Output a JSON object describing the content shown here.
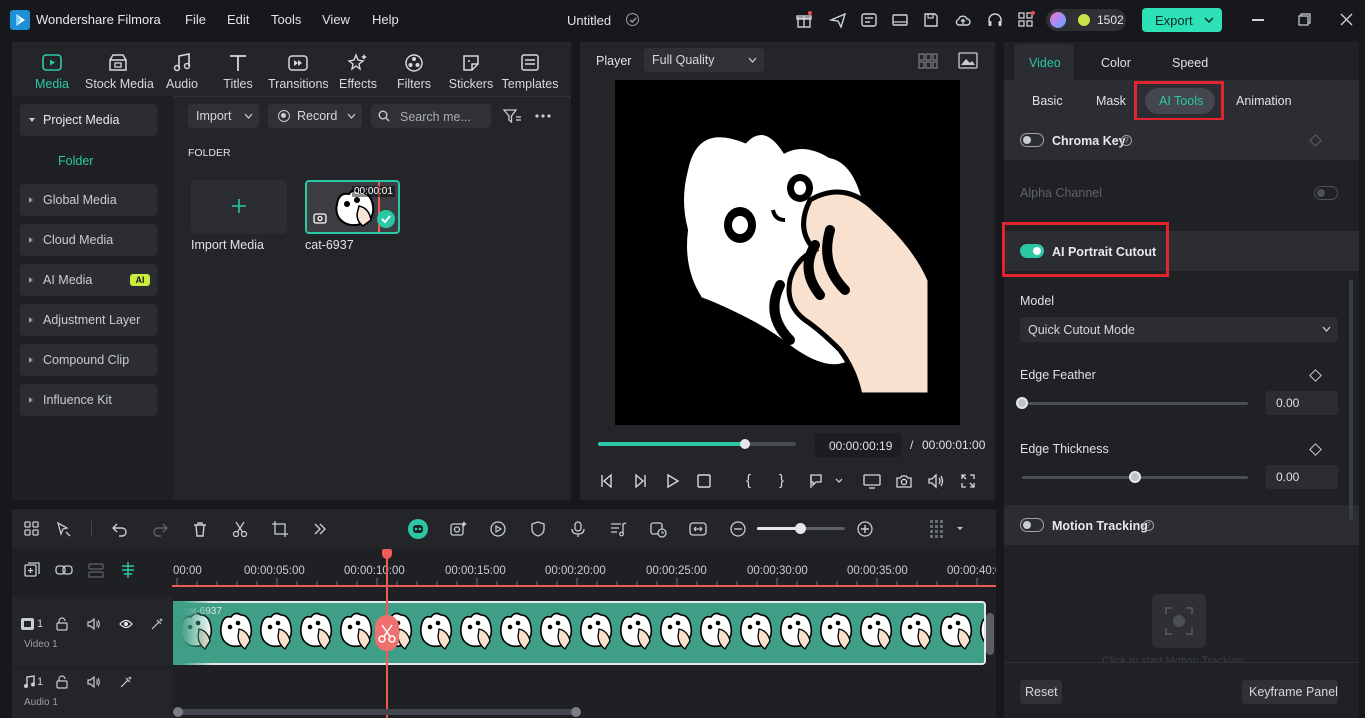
{
  "app": {
    "title": "Wondershare Filmora",
    "document_title": "Untitled",
    "credits": "1502",
    "export_label": "Export",
    "menu": [
      "File",
      "Edit",
      "Tools",
      "View",
      "Help"
    ]
  },
  "media_toolbar": {
    "tabs": [
      {
        "label": "Media",
        "icon": "media-icon",
        "active": true
      },
      {
        "label": "Stock Media",
        "icon": "stock-media-icon"
      },
      {
        "label": "Audio",
        "icon": "audio-icon"
      },
      {
        "label": "Titles",
        "icon": "titles-icon"
      },
      {
        "label": "Transitions",
        "icon": "transitions-icon"
      },
      {
        "label": "Effects",
        "icon": "effects-icon"
      },
      {
        "label": "Filters",
        "icon": "filters-icon"
      },
      {
        "label": "Stickers",
        "icon": "stickers-icon"
      },
      {
        "label": "Templates",
        "icon": "templates-icon"
      }
    ]
  },
  "sidebar": {
    "project_media": "Project Media",
    "folder": "Folder",
    "items": [
      "Global Media",
      "Cloud Media",
      "AI Media",
      "Adjustment Layer",
      "Compound Clip",
      "Influence Kit"
    ],
    "ai_badge": "AI"
  },
  "media_panel": {
    "import_label": "Import",
    "record_label": "Record",
    "search_placeholder": "Search me...",
    "folder_heading": "FOLDER",
    "import_media_label": "Import Media",
    "clip": {
      "name": "cat-6937",
      "duration": "00:00:01"
    }
  },
  "player": {
    "label": "Player",
    "quality": "Full Quality",
    "current_time": "00:00:00:19",
    "separator": "/",
    "total_time": "00:00:01:00",
    "progress": 0.74
  },
  "properties": {
    "main_tabs": [
      "Video",
      "Color",
      "Speed"
    ],
    "active_main_tab": "Video",
    "sub_tabs": [
      "Basic",
      "Mask",
      "AI Tools",
      "Animation"
    ],
    "active_sub_tab": "AI Tools",
    "chroma_key": {
      "label": "Chroma Key",
      "on": false
    },
    "alpha_channel": {
      "label": "Alpha Channel",
      "on": false
    },
    "ai_portrait": {
      "label": "AI Portrait Cutout",
      "on": true
    },
    "model_label": "Model",
    "model_value": "Quick Cutout Mode",
    "edge_feather": {
      "label": "Edge Feather",
      "value": "0.00",
      "level": 0.0
    },
    "edge_thickness": {
      "label": "Edge Thickness",
      "value": "0.00",
      "level": 0.5
    },
    "motion_tracking": {
      "label": "Motion Tracking",
      "on": false,
      "hint": "Click to start Motion Tracking"
    },
    "reset_label": "Reset",
    "keyframe_label": "Keyframe Panel"
  },
  "timeline": {
    "ruler": [
      "00:00",
      "00:00:05:00",
      "00:00:10:00",
      "00:00:15:00",
      "00:00:20:00",
      "00:00:25:00",
      "00:00:30:00",
      "00:00:35:00",
      "00:00:40:0"
    ],
    "clip_name": "cat-6937",
    "video_track_label": "Video 1",
    "video_track_num": "1",
    "audio_track_label": "Audio 1",
    "audio_track_num": "1"
  },
  "colors": {
    "accent": "#2bc8a6",
    "export": "#2ee0b6",
    "playhead": "#f05a5a",
    "highlight": "#e3232d",
    "clip": "#3e9f86"
  }
}
